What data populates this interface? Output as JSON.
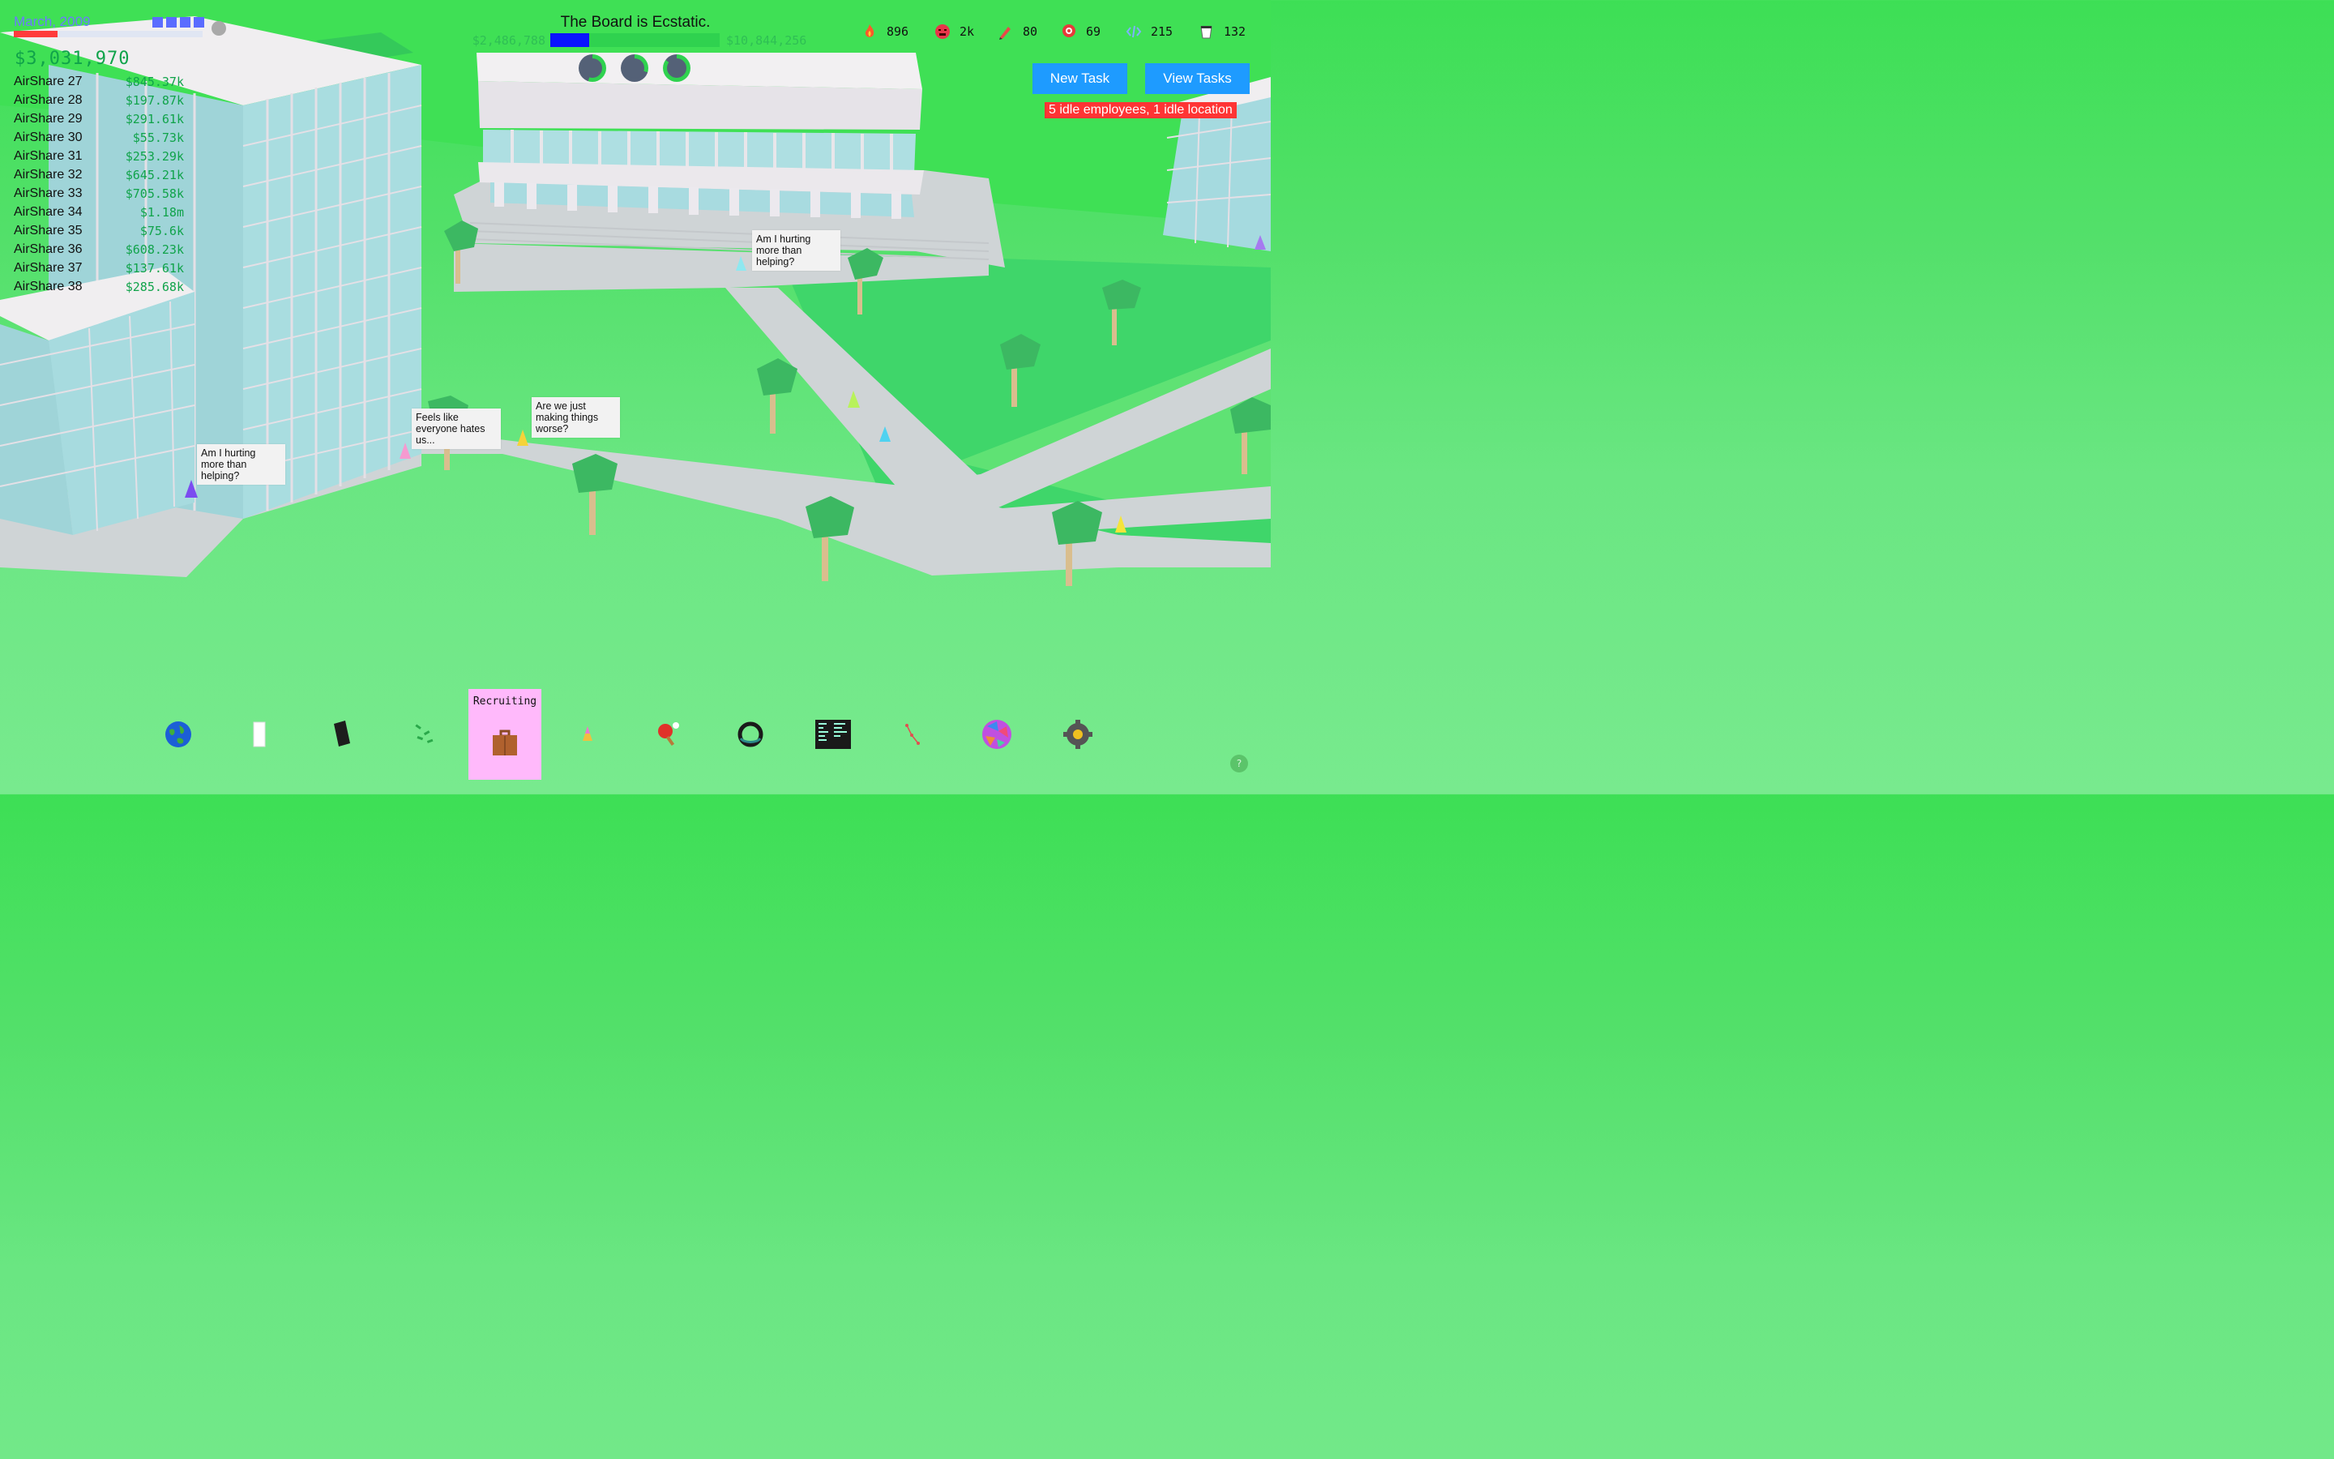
{
  "hud": {
    "date": "March, 2009",
    "month_progress": 0.23,
    "speed_levels": 4,
    "cash": "$3,031,970",
    "products": [
      {
        "name": "AirShare 27",
        "value": "$845.37k"
      },
      {
        "name": "AirShare 28",
        "value": "$197.87k"
      },
      {
        "name": "AirShare 29",
        "value": "$291.61k"
      },
      {
        "name": "AirShare 30",
        "value": "$55.73k"
      },
      {
        "name": "AirShare 31",
        "value": "$253.29k"
      },
      {
        "name": "AirShare 32",
        "value": "$645.21k"
      },
      {
        "name": "AirShare 33",
        "value": "$705.58k"
      },
      {
        "name": "AirShare 34",
        "value": "$1.18m"
      },
      {
        "name": "AirShare 35",
        "value": "$75.6k"
      },
      {
        "name": "AirShare 36",
        "value": "$608.23k"
      },
      {
        "name": "AirShare 37",
        "value": "$137.61k"
      },
      {
        "name": "AirShare 38",
        "value": "$285.68k"
      }
    ]
  },
  "board": {
    "status": "The Board is Ecstatic.",
    "low": "$2,486,788",
    "high": "$10,844,256",
    "progress": 0.23
  },
  "gauges": [
    {
      "name": "gauge-1",
      "value": 0.55
    },
    {
      "name": "gauge-2",
      "value": 0.3
    },
    {
      "name": "gauge-3",
      "value": 0.85
    }
  ],
  "stats": [
    {
      "icon": "hype-icon",
      "value": "896"
    },
    {
      "icon": "outrage-icon",
      "value": "2k"
    },
    {
      "icon": "design-icon",
      "value": "80"
    },
    {
      "icon": "marketing-icon",
      "value": "69"
    },
    {
      "icon": "engineering-icon",
      "value": "215"
    },
    {
      "icon": "coffee-icon",
      "value": "132"
    }
  ],
  "buttons": {
    "new_task": "New Task",
    "view_tasks": "View Tasks"
  },
  "idle_warning": "5 idle employees, 1 idle location",
  "bubbles": [
    {
      "text": "Am I hurting more than helping?"
    },
    {
      "text": "Feels like everyone hates us..."
    },
    {
      "text": "Are we just making things worse?"
    },
    {
      "text": "Am I hurting more than helping?"
    }
  ],
  "toolbar": {
    "active_label": "Recruiting",
    "tools": [
      "globe-icon",
      "column-icon",
      "phone-icon",
      "money-icon",
      "briefcase-icon",
      "party-hat-icon",
      "ping-pong-icon",
      "smartwatch-icon",
      "code-screen-icon",
      "network-icon",
      "sphere-icon",
      "settings-icon"
    ]
  },
  "help_label": "?",
  "colors": {
    "grass": "#5fe274",
    "sky_green": "#3ddf55",
    "accent_blue": "#1e9bff",
    "money_green": "#10a34a",
    "warning_red": "#ff3434",
    "active_tool": "#ffb9fb"
  }
}
